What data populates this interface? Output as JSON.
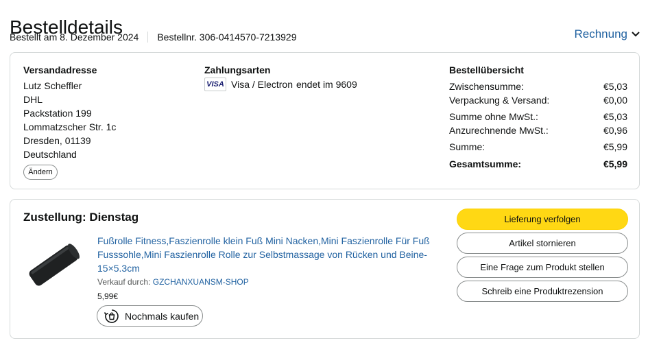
{
  "header": {
    "title": "Bestelldetails",
    "order_date": "Bestellt am 8. Dezember 2024",
    "order_number": "Bestellnr. 306-0414570-7213929",
    "invoice_label": "Rechnung"
  },
  "shipping": {
    "title": "Versandadresse",
    "lines": [
      "Lutz Scheffler",
      "DHL",
      "Packstation 199",
      "Lommatzscher Str. 1c",
      "Dresden, 01139",
      "Deutschland"
    ],
    "change_label": "Ändern"
  },
  "payment": {
    "title": "Zahlungsarten",
    "card_brand": "VISA",
    "card_name": "Visa / Electron",
    "card_suffix": "endet im 9609"
  },
  "summary": {
    "title": "Bestellübersicht",
    "rows": [
      {
        "label": "Zwischensumme:",
        "value": "€5,03"
      },
      {
        "label": "Verpackung & Versand:",
        "value": "€0,00"
      },
      {
        "label": "Summe ohne MwSt.:",
        "value": "€5,03"
      },
      {
        "label": "Anzurechnende MwSt.:",
        "value": "€0,96"
      },
      {
        "label": "Summe:",
        "value": "€5,99"
      },
      {
        "label": "Gesamtsumme:",
        "value": "€5,99"
      }
    ]
  },
  "delivery": {
    "title": "Zustellung: Dienstag",
    "product": {
      "title": "Fußrolle Fitness,Faszienrolle klein Fuß Mini Nacken,Mini Faszienrolle Für Fuß Fusssohle,Mini Faszienrolle Rolle zur Selbstmassage von Rücken und Beine-15×5.3cm",
      "seller_prefix": "Verkauf durch:",
      "seller_name": "GZCHANXUANSM-SHOP",
      "price": "5,99€",
      "rebuy_label": "Nochmals kaufen"
    },
    "actions": {
      "track": "Lieferung verfolgen",
      "cancel": "Artikel stornieren",
      "question": "Eine Frage zum Produkt stellen",
      "review": "Schreib eine Produktrezension"
    }
  },
  "colors": {
    "link": "#2162a1",
    "primary_button": "#ffd814",
    "border": "#d5d9d9"
  }
}
